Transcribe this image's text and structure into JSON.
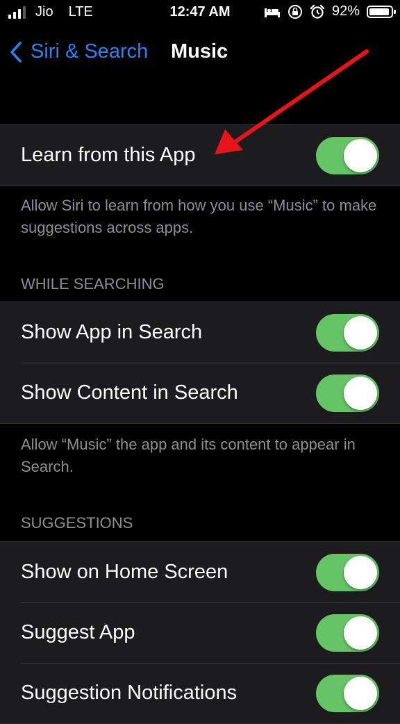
{
  "status_bar": {
    "carrier": "Jio",
    "network": "LTE",
    "time": "12:47 AM",
    "battery": "92%",
    "battery_level": 0.92,
    "icons": [
      "signal-icon",
      "bed-icon",
      "rotation-lock-icon",
      "alarm-icon",
      "battery-icon"
    ]
  },
  "nav": {
    "back_label": "Siri & Search",
    "title": "Music"
  },
  "learn": {
    "label": "Learn from this App",
    "toggle_on": true,
    "footer": "Allow Siri to learn from how you use “Music” to make suggestions across apps."
  },
  "while_searching": {
    "header": "WHILE SEARCHING",
    "items": [
      {
        "label": "Show App in Search",
        "toggle_on": true
      },
      {
        "label": "Show Content in Search",
        "toggle_on": true
      }
    ],
    "footer": "Allow “Music” the app and its content to appear in Search."
  },
  "suggestions": {
    "header": "SUGGESTIONS",
    "items": [
      {
        "label": "Show on Home Screen",
        "toggle_on": true
      },
      {
        "label": "Suggest App",
        "toggle_on": true
      },
      {
        "label": "Suggestion Notifications",
        "toggle_on": true
      }
    ]
  },
  "colors": {
    "accent": "#2f80ed",
    "toggle_on": "#65c466",
    "annotation_arrow": "#e8141c"
  }
}
